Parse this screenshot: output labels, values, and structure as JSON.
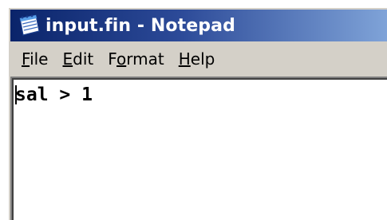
{
  "window": {
    "title": "input.fin - Notepad",
    "title_bar_color": "#0a246a"
  },
  "menu": [
    {
      "pre": "",
      "accel": "F",
      "rest": "ile"
    },
    {
      "pre": "",
      "accel": "E",
      "rest": "dit"
    },
    {
      "pre": "F",
      "accel": "o",
      "rest": "rmat"
    },
    {
      "pre": "",
      "accel": "H",
      "rest": "elp"
    }
  ],
  "editor": {
    "content": "sal > 1"
  },
  "icons": {
    "app": "notepad-icon"
  }
}
